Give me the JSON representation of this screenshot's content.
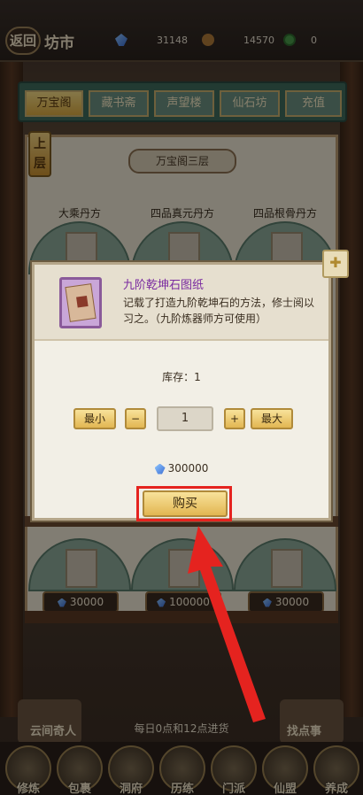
{
  "topbar": {
    "back_label": "返回",
    "title": "坊市",
    "resources": [
      {
        "icon": "spirit-stone-icon",
        "value": "31148"
      },
      {
        "icon": "money-bag-icon",
        "value": "14570"
      },
      {
        "icon": "jade-coin-icon",
        "value": "0"
      }
    ]
  },
  "tabs": [
    {
      "label": "万宝阁",
      "active": true
    },
    {
      "label": "藏书斋",
      "active": false
    },
    {
      "label": "声望楼",
      "active": false
    },
    {
      "label": "仙石坊",
      "active": false
    },
    {
      "label": "充值",
      "active": false
    }
  ],
  "shelf": {
    "floor_badge": "上层",
    "title": "万宝阁三层",
    "row1_items": [
      "大乘丹方",
      "四品真元丹方",
      "四品根骨丹方"
    ],
    "row2_prices": [
      "30000",
      "100000",
      "30000"
    ]
  },
  "modal": {
    "item_title": "九阶乾坤石图纸",
    "item_desc": "记载了打造九阶乾坤石的方法，修士阅以习之。（九阶炼器师方可使用）",
    "stock": "库存：1",
    "min_label": "最小",
    "minus_label": "−",
    "quantity": "1",
    "plus_label": "+",
    "max_label": "最大",
    "total_price": "300000",
    "buy_label": "购买"
  },
  "bottom": {
    "restock_text": "每日0点和12点进货",
    "left_deco_label": "云间奇人",
    "right_deco_label": "找点事",
    "nav": [
      "修炼",
      "包裹",
      "洞府",
      "历练",
      "门派",
      "仙盟",
      "养成"
    ]
  },
  "colors": {
    "accent_gold": "#e2b652",
    "highlight_red": "#e5231f",
    "item_title_purple": "#7a2aa0"
  }
}
